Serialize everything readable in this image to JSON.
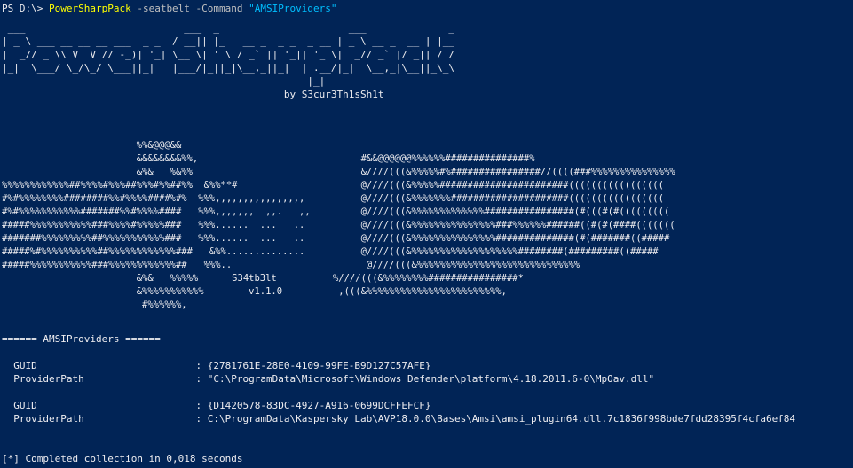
{
  "prompt": {
    "ps_prompt": "PS D:\\> ",
    "command": "PowerSharpPack",
    "param1": " -seatbelt",
    "param2": " -Command",
    "string_arg": " \"AMSIProviders\""
  },
  "banner": {
    "logo_lines": [
      " ___                           ___  _                      ___              _    ",
      "| _ \\ ___ __ __ __ ___  _ _  / __|| |_   __ _  _ _  _ __ | _ \\ __ _  __ | |__ ",
      "|  _// _ \\\\ V  V // -_)| '_| \\__ \\| ' \\ / _` || '_|| '_ \\|  _// _` |/ _|| / / ",
      "|_|  \\___/ \\_/\\_/ \\___||_|   |___/|_||_|\\__,_||_|  | .__/|_|  \\__,_|\\__||_\\_\\ ",
      "                                                    |_|                        "
    ],
    "byline": "                                                by S3cur3Th1sSh1t"
  },
  "art": {
    "lines": [
      "                        %%&@@@&&                                                                    ",
      "                        &&&&&&&&%%,                             #&&@@@@@@%%%%%%###############%     ",
      "                        &%&   %&%%                              &////(((&%%%%%#%################//((((###%%%%%%%%%%%%%%%",
      "%%%%%%%%%%%%##%%%%#%%%##%%%#%%##%%  &%%**#                      @////(((&%%%%%#######################(((((((((((((((((",
      "#%#%%%%%%%%########%%#%%%%####%#%  %%%,,,,,,,,,,,,,,,,          @////(((&%%%%%%%#####################(((((((((((((((((",
      "#%#%%%%%%%%%%%#######%%#%%%%####   %%%,,,,,,,  ,,.   ,,         @////(((&%%%%%%%%%%%%%################(#(((#(#(((((((((",
      "#####%%%%%%%%%%%###%%%%#%%%%%###   %%%......  ...   ..          @////(((&%%%%%%%%%%%%%%%###%%%%%%######((#(#(####(((((((",
      "#######%%%%%%%%%##%%%%%%%%%%%###   %%%......  ...   ..          @////(((&%%%%%%%%%%%%%%%##############(#(#######((#####",
      "#####%#%%%%%%%%%%##%%%%%%%%%%%%###   &%%..............          @////(((&%%%%%%%%%%%%%%%%%%%########(#########((#####",
      "#####%%%%%%%%%%%###%%%%%%%%%%%%##   %%%..                        @////(((&%%%%%%%%%%%%%%%%%%%%%%%%%%%%%",
      "                        &%&   %%%%%      S34tb3lt          %////(((&%%%%%%%%################*   ",
      "                        &%%%%%%%%%%%        v1.1.0          ,(((&%%%%%%%%%%%%%%%%%%%%%%%%,    ",
      "                         #%%%%%%,                                                                     "
    ]
  },
  "output": {
    "header": "====== AMSIProviders ======",
    "providers": [
      {
        "guid_label": "  GUID                           : ",
        "guid_value": "{2781761E-28E0-4109-99FE-B9D127C57AFE}",
        "path_label": "  ProviderPath                   : ",
        "path_value": "\"C:\\ProgramData\\Microsoft\\Windows Defender\\platform\\4.18.2011.6-0\\MpOav.dll\""
      },
      {
        "guid_label": "  GUID                           : ",
        "guid_value": "{D1420578-83DC-4927-A916-0699DCFFEFCF}",
        "path_label": "  ProviderPath                   : ",
        "path_value": "C:\\ProgramData\\Kaspersky Lab\\AVP18.0.0\\Bases\\Amsi\\amsi_plugin64.dll.7c1836f998bde7fdd28395f4cfa6ef84"
      }
    ],
    "footer": "[*] Completed collection in 0,018 seconds"
  },
  "colors": {
    "background": "#012456",
    "text": "#eeedf0",
    "command": "#ffff00",
    "param": "#c0c0c0",
    "string": "#00bfff"
  }
}
